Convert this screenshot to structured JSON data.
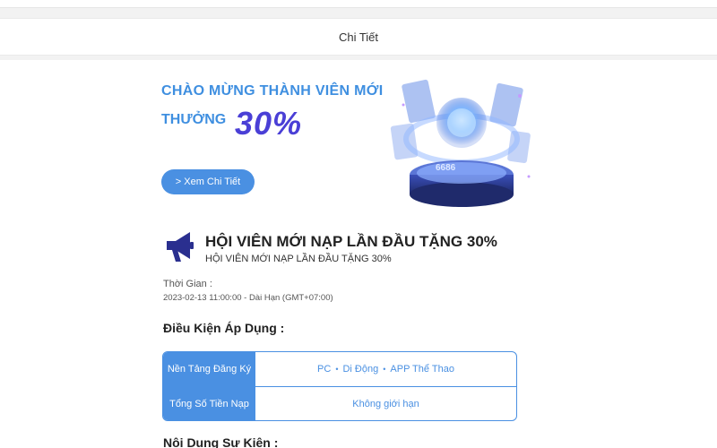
{
  "header": {
    "title": "Chi Tiết"
  },
  "banner": {
    "line1": "CHÀO MỪNG THÀNH VIÊN MỚI",
    "line2": "THƯỞNG",
    "percent": "30%",
    "button_label": "> Xem Chi Tiết",
    "device_label": "6686"
  },
  "promo": {
    "title": "HỘI VIÊN MỚI NẠP LẦN ĐẦU TẶNG 30%",
    "subtitle": "HỘI VIÊN MỚI NẠP LẦN ĐẦU TẶNG 30%",
    "time_label": "Thời Gian :",
    "time_value": "2023-02-13 11:00:00 - Dài Hạn (GMT+07:00)"
  },
  "conditions": {
    "title": "Điều Kiện Áp Dụng :",
    "rows": [
      {
        "key": "Nền Tảng Đăng Ký",
        "values": [
          "PC",
          "Di Động",
          "APP Thể Thao"
        ]
      },
      {
        "key": "Tổng Số Tiền Nạp",
        "values": [
          "Không giới hạn"
        ]
      }
    ]
  },
  "event_content": {
    "title": "Nội Dung Sự Kiện :"
  },
  "colors": {
    "accent": "#4a90e2",
    "banner_text": "#3f8fe0",
    "percent": "#4a3fd6",
    "icon": "#2a2f8f"
  }
}
